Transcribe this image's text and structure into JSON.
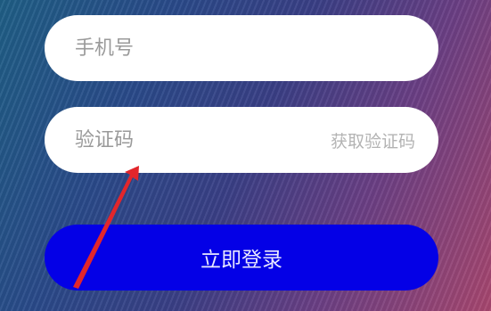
{
  "form": {
    "phone_placeholder": "手机号",
    "code_placeholder": "验证码",
    "get_code_label": "获取验证码",
    "login_label": "立即登录"
  },
  "colors": {
    "login_button": "#0400e6",
    "annotation_arrow": "#e2262b"
  }
}
